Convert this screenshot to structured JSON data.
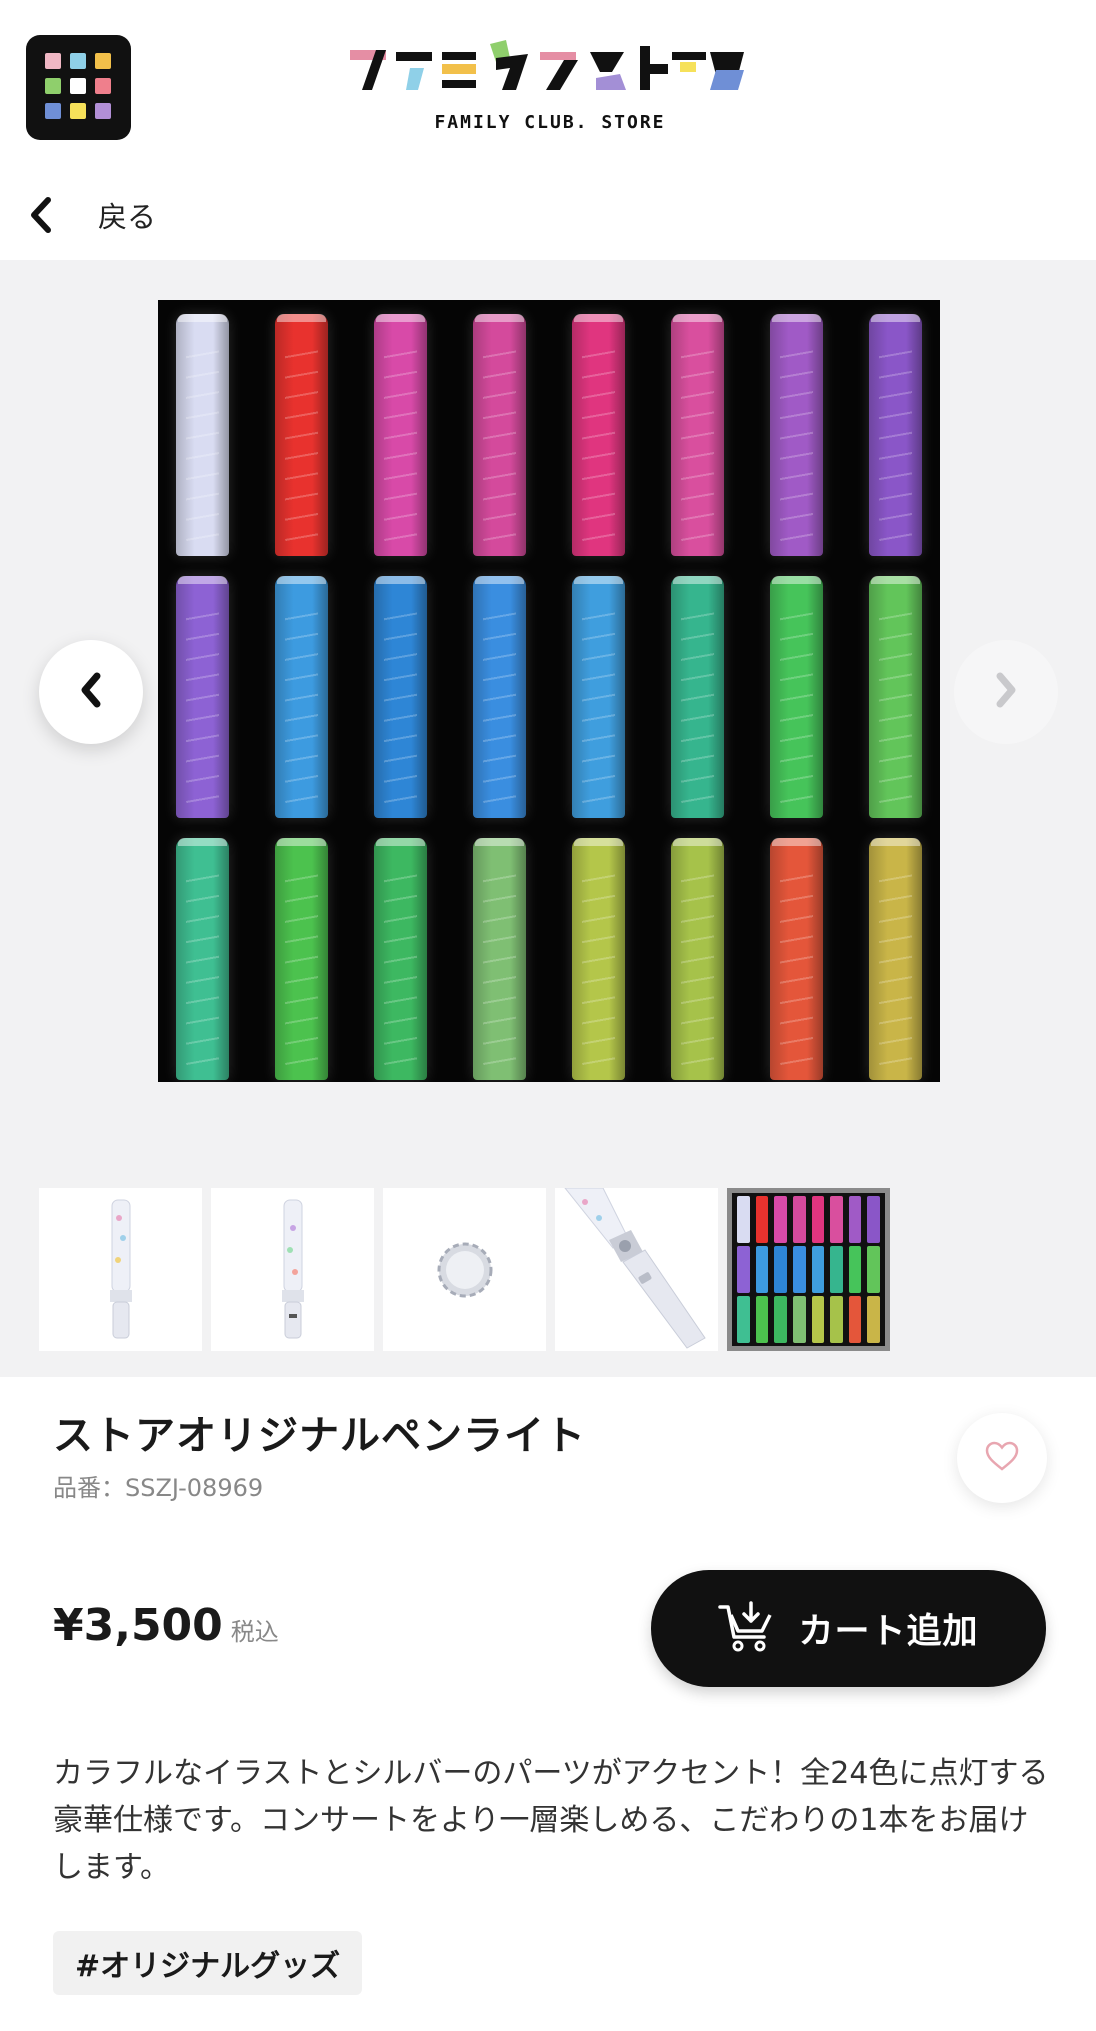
{
  "header": {
    "logo_text": "ファミクラストア",
    "logo_subtitle": "FAMILY CLUB. STORE",
    "menu_icon": "app-grid-icon"
  },
  "nav": {
    "back_label": "戻る",
    "back_icon": "chevron-left-icon"
  },
  "gallery": {
    "prev_icon": "chevron-left-icon",
    "next_icon": "chevron-right-icon",
    "thumbnail_count": 5,
    "selected_thumbnail_index": 4,
    "light_colors": [
      "#d9dcf2",
      "#e8322e",
      "#d84aa8",
      "#d44a9c",
      "#e0357f",
      "#d94f9e",
      "#a05ac6",
      "#8a56c8",
      "#8d62d4",
      "#3d9be0",
      "#2e86d6",
      "#3a8ee0",
      "#3f9ede",
      "#36b58e",
      "#46c45a",
      "#62c55a",
      "#3fbf92",
      "#4cc24e",
      "#3db861",
      "#7fbf73",
      "#b4c64a",
      "#a6c24a",
      "#e4563a",
      "#c9b548"
    ]
  },
  "product": {
    "title": "ストアオリジナルペンライト",
    "sku": "品番：SSZJ-08969",
    "price": "¥3,500",
    "tax_label": "税込",
    "cart_button_label": "カート追加",
    "cart_icon": "cart-add-icon",
    "favorite_icon": "heart-icon",
    "description": "カラフルなイラストとシルバーのパーツがアクセント！全24色に点灯する豪華仕様です。コンサートをより一層楽しめる、こだわりの1本をお届けします。",
    "tag": "#オリジナルグッズ"
  },
  "colors": {
    "accent_dark": "#111111",
    "gallery_bg": "#f2f2f3",
    "heart": "#e8a6b0"
  }
}
